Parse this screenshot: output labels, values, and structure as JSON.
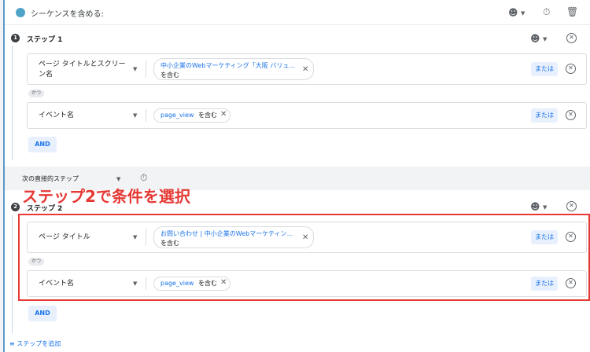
{
  "sequence": {
    "title": "シーケンスを含める:",
    "accent_color": "#4fa3c7",
    "header_icons": [
      "person-icon",
      "caret-down-icon",
      "timer-off-icon",
      "trash-icon"
    ]
  },
  "step1": {
    "number": "1",
    "label": "ステップ 1",
    "conditions": [
      {
        "dimension": "ページ タイトルとスクリーン名",
        "dimension_line1": "ページ タイトルとスクリー",
        "dimension_line2": "ン名",
        "value": "中小企業のWebマーケティング「大阪 バリュ...",
        "operator": "を含む"
      },
      {
        "dimension": "イベント名",
        "value": "page_view",
        "operator": "を含む"
      }
    ],
    "and_badge": "かつ",
    "or_label": "または",
    "and_button": "AND"
  },
  "timing": {
    "select_label": "次の直接的ステップ"
  },
  "annotation": {
    "text": "ステップ2で条件を選択",
    "color": "#e53935"
  },
  "step2": {
    "number": "2",
    "label": "ステップ 2",
    "conditions": [
      {
        "dimension": "ページ タイトル",
        "value": "お問い合わせ | 中小企業のWebマーケティン...",
        "operator": "を含む"
      },
      {
        "dimension": "イベント名",
        "value": "page_view",
        "operator": "を含む"
      }
    ],
    "and_badge": "かつ",
    "or_label": "または",
    "and_button": "AND"
  },
  "footer": {
    "add_step": "ステップを追加"
  }
}
